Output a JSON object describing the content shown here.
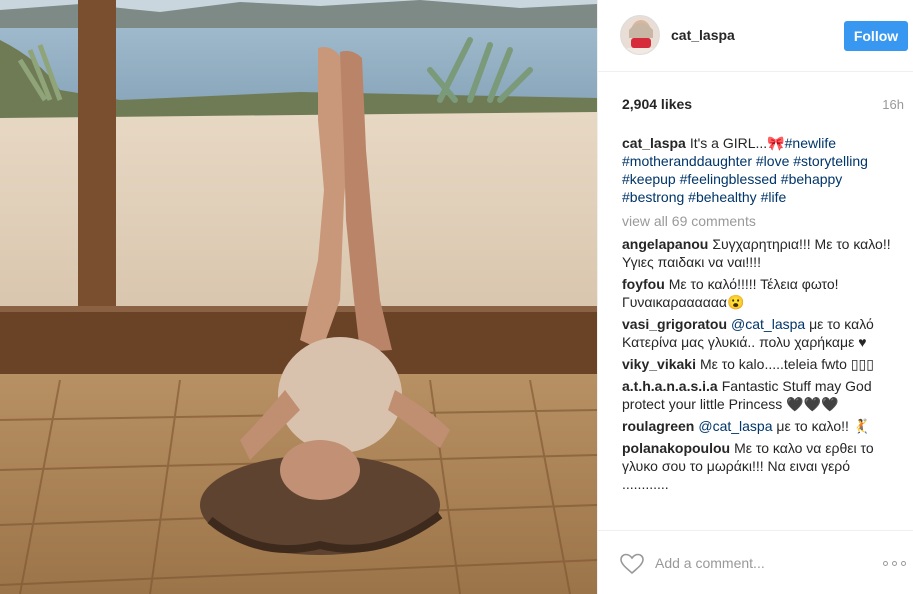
{
  "header": {
    "username": "cat_laspa",
    "follow_label": "Follow"
  },
  "meta": {
    "likes": "2,904 likes",
    "time": "16h"
  },
  "caption": {
    "username": "cat_laspa",
    "text": "It's a GIRL...🎀",
    "hashtags": [
      "#newlife",
      "#motheranddaughter",
      "#love",
      "#storytelling",
      "#keepup",
      "#feelingblessed",
      "#behappy",
      "#bestrong",
      "#behealthy",
      "#life"
    ]
  },
  "view_all": "view all 69 comments",
  "comments": [
    {
      "username": "angelapanou",
      "text": "Συγχαρητηρια!!! Με το καλο!! Υγιες παιδακι να ναι!!!!"
    },
    {
      "username": "foyfou",
      "text": "Με το καλό!!!!! Τέλεια φωτο! Γυναικαραααααα😮"
    },
    {
      "username": "vasi_grigoratou",
      "mention": "@cat_laspa",
      "text": "με το καλό Κατερίνα μας γλυκιά.. πολυ χαρήκαμε ♥"
    },
    {
      "username": "viky_vikaki",
      "text": "Με το kalo.....teleia fwto ▯▯▯"
    },
    {
      "username": "a.t.h.a.n.a.s.i.a",
      "text": "Fantastic Stuff may God protect your little Princess 🖤🖤🖤"
    },
    {
      "username": "roulagreen",
      "mention": "@cat_laspa",
      "text": "με το καλο!! 🤾"
    },
    {
      "username": "polanakopoulou",
      "text": "Με το καλο να ερθει το γλυκο σου το μωράκι!!! Να ειναι γερό ............"
    }
  ],
  "footer": {
    "add_comment_placeholder": "Add a comment...",
    "heart_icon": "heart-outline-icon",
    "more_icon": "more-options-icon"
  },
  "colors": {
    "follow_button": "#3897f0",
    "hashtag": "#003569",
    "muted": "#999999"
  }
}
